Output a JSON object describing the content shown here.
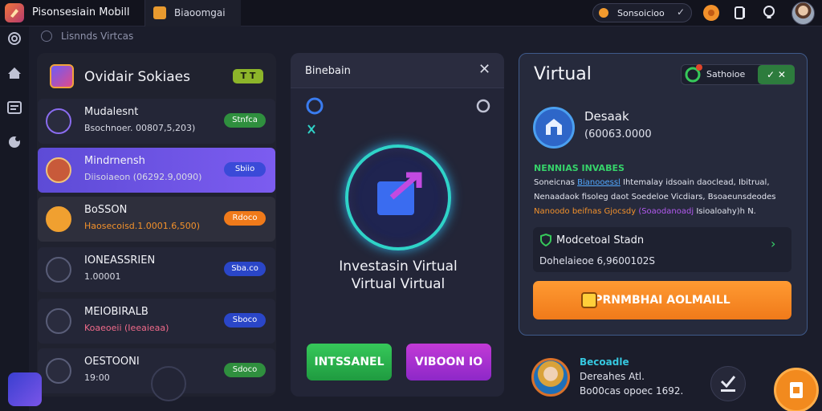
{
  "topbar": {
    "app_title": "Pisonsesiain Mobill",
    "tab_label": "Biaoomgai",
    "session_label": "Sonsoicioo",
    "icons": [
      "app-logo",
      "tab-icon",
      "session-dot",
      "chevron-down-icon",
      "notification-icon",
      "document-icon",
      "bulb-icon",
      "avatar"
    ]
  },
  "breadcrumb": {
    "label": "Lisnnds Virtcas"
  },
  "left_panel": {
    "title": "Ovidair Sokiaes",
    "badge": "T T",
    "rows": [
      {
        "title": "Mudalesnt",
        "sub": "Bsochnoer. 00807,5,203)",
        "pill": "Stnfca",
        "pill_color": "#2f8f3e",
        "icon": "document-icon"
      },
      {
        "title": "Mindrnensh",
        "sub": "Diisoiaeon (06292.9,0090)",
        "pill": "Sbiio",
        "pill_color": "#3a4ad8",
        "icon": "avatar"
      },
      {
        "title": "BoSSON",
        "sub": "Haosecoisd.1.0001.6,500)",
        "pill": "Rdoco",
        "pill_color": "#f07a1a",
        "icon": "tag-icon"
      },
      {
        "title": "IONEASSRIEN",
        "sub": "1.00001",
        "pill": "Sba.co",
        "pill_color": "#2a46c8",
        "icon": "printer-icon"
      },
      {
        "title": "MEIOBIRALB",
        "sub": "Koaeoeii (Ieeaieaa)",
        "pill": "Sboco",
        "pill_color": "#2a46c8",
        "icon": "chart-icon"
      },
      {
        "title": "OESTOONI",
        "sub": "19:00",
        "pill": "Sdoco",
        "pill_color": "#2f8f3e",
        "icon": "bug-icon"
      }
    ]
  },
  "center_card": {
    "title": "Binebain",
    "close": "✕",
    "heading_line1": "Investasin Virtual",
    "heading_line2": "Virtual Virtual",
    "btn_green": "INTSSANEL",
    "btn_purple": "VIBOON IO"
  },
  "right_card": {
    "title": "Virtual",
    "pill_label": "Sathoioe",
    "pill_ok": "✓ ✕",
    "name": "Desaak",
    "code": "(60063.0000",
    "section": "NENNIAS INVABES",
    "line1_a": "Soneicnas",
    "line1_b": "Bianooessl",
    "line1_c": "Ihtemalay idsoain daoclead, Ibitrual,",
    "line2": "Nenaadaok fisoleg daot Soedeloe Vicdiars, Bsoaeunsdeodes",
    "line3_a": "Nanoodo beifnas",
    "line3_b": "Gjocsdy",
    "line3_c": "(Soaodanoadj",
    "line3_d": "Isioaloahy)h N.",
    "sub_title": "Modcetoal Stadn",
    "sub_meta": "Dohelaieoe 6,9600102S",
    "cta": "PRNMBHAI AOLMAILL"
  },
  "bottom_right": {
    "title": "Becoadle",
    "line1": "Dereahes Atl.",
    "line2": "Bo00cas opoec 1692."
  },
  "colors": {
    "accent_purple": "#6e55e6",
    "accent_orange": "#f28a1e",
    "accent_green": "#36c85a",
    "accent_teal": "#2fd3c8"
  }
}
